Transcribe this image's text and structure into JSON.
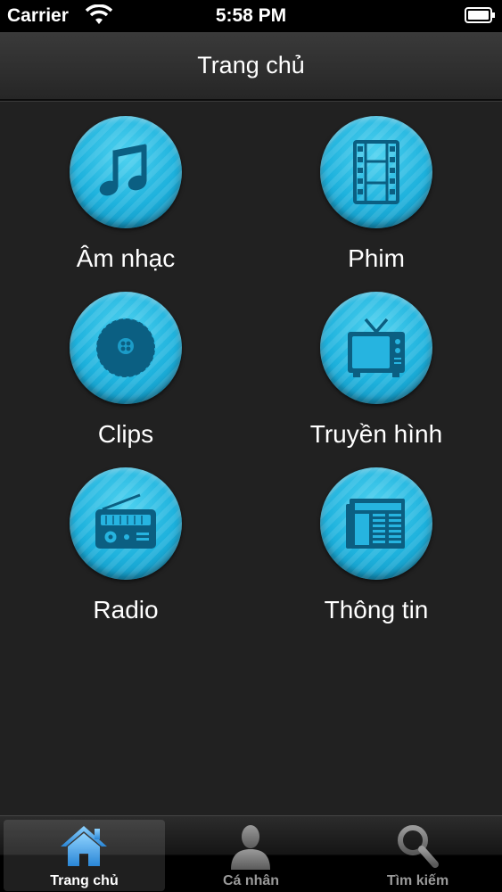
{
  "status_bar": {
    "carrier": "Carrier",
    "time": "5:58 PM"
  },
  "nav_bar": {
    "title": "Trang chủ"
  },
  "menu": {
    "items": [
      {
        "label": "Âm nhạc",
        "icon": "music-note-icon"
      },
      {
        "label": "Phim",
        "icon": "film-strip-icon"
      },
      {
        "label": "Clips",
        "icon": "video-clip-icon"
      },
      {
        "label": "Truyền hình",
        "icon": "television-icon"
      },
      {
        "label": "Radio",
        "icon": "radio-icon"
      },
      {
        "label": "Thông tin",
        "icon": "newspaper-icon"
      }
    ]
  },
  "tab_bar": {
    "tabs": [
      {
        "label": "Trang chủ",
        "icon": "home-icon",
        "active": true
      },
      {
        "label": "Cá nhân",
        "icon": "person-icon",
        "active": false
      },
      {
        "label": "Tìm kiếm",
        "icon": "search-icon",
        "active": false
      }
    ]
  },
  "colors": {
    "accent": "#1eb2dd",
    "active_tab_icon": "#3aa0e6",
    "background": "#212121"
  }
}
